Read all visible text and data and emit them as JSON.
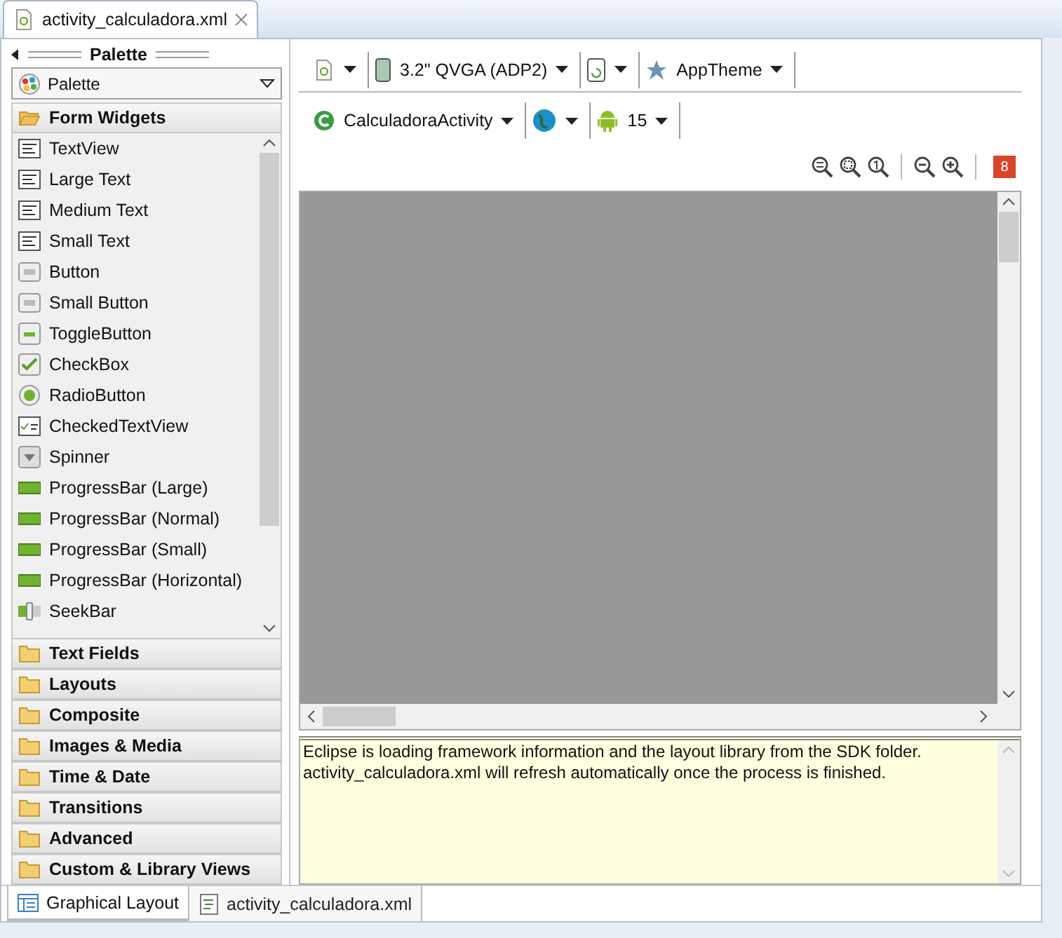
{
  "editor_tab": {
    "title": "activity_calculadora.xml"
  },
  "palette": {
    "title": "Palette",
    "selector": "Palette",
    "categories": [
      {
        "label": "Form Widgets",
        "expanded": true,
        "items": [
          {
            "label": "TextView",
            "kind": "text"
          },
          {
            "label": "Large Text",
            "kind": "text"
          },
          {
            "label": "Medium Text",
            "kind": "text"
          },
          {
            "label": "Small Text",
            "kind": "text"
          },
          {
            "label": "Button",
            "kind": "ok"
          },
          {
            "label": "Small Button",
            "kind": "ok"
          },
          {
            "label": "ToggleButton",
            "kind": "toggle"
          },
          {
            "label": "CheckBox",
            "kind": "check"
          },
          {
            "label": "RadioButton",
            "kind": "radio"
          },
          {
            "label": "CheckedTextView",
            "kind": "checkedtext"
          },
          {
            "label": "Spinner",
            "kind": "spinner"
          },
          {
            "label": "ProgressBar (Large)",
            "kind": "progress"
          },
          {
            "label": "ProgressBar (Normal)",
            "kind": "progress"
          },
          {
            "label": "ProgressBar (Small)",
            "kind": "progress"
          },
          {
            "label": "ProgressBar (Horizontal)",
            "kind": "progress"
          },
          {
            "label": "SeekBar",
            "kind": "seek"
          }
        ]
      },
      {
        "label": "Text Fields",
        "expanded": false
      },
      {
        "label": "Layouts",
        "expanded": false
      },
      {
        "label": "Composite",
        "expanded": false
      },
      {
        "label": "Images & Media",
        "expanded": false
      },
      {
        "label": "Time & Date",
        "expanded": false
      },
      {
        "label": "Transitions",
        "expanded": false
      },
      {
        "label": "Advanced",
        "expanded": false
      },
      {
        "label": "Custom & Library Views",
        "expanded": false
      }
    ]
  },
  "toolbar_rows": [
    [
      {
        "kind": "file"
      },
      {
        "kind": "device",
        "label": "3.2\" QVGA (ADP2)"
      },
      {
        "kind": "rotate"
      },
      {
        "kind": "theme",
        "label": "AppTheme"
      }
    ],
    [
      {
        "kind": "activity",
        "label": "CalculadoraActivity"
      },
      {
        "kind": "locale"
      },
      {
        "kind": "android",
        "label": "15"
      }
    ]
  ],
  "zoom_badge": "8",
  "message_lines": [
    "Eclipse is loading framework information and the layout library from the SDK folder.",
    "activity_calculadora.xml will refresh automatically once the process is finished."
  ],
  "bottom_tabs": [
    {
      "label": "Graphical Layout",
      "selected": true,
      "kind": "layout"
    },
    {
      "label": "activity_calculadora.xml",
      "selected": false,
      "kind": "xml"
    }
  ]
}
